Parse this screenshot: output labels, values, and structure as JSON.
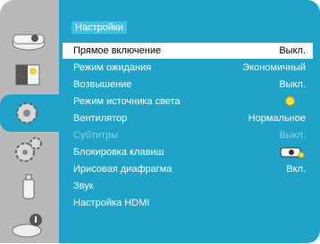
{
  "panel": {
    "title": "Настройки"
  },
  "sidebar": {
    "icons": [
      {
        "name": "projector-icon"
      },
      {
        "name": "image-adjust-icon"
      },
      {
        "name": "setting-gear-icon"
      },
      {
        "name": "expanded-settings-icon"
      },
      {
        "name": "usb-memory-icon"
      },
      {
        "name": "info-icon"
      }
    ],
    "active_index": 2
  },
  "menu": {
    "items": [
      {
        "label": "Прямое включение",
        "value": "Выкл."
      },
      {
        "label": "Режим ожидания",
        "value": "Экономичный"
      },
      {
        "label": "Возвышение",
        "value": "Выкл."
      },
      {
        "label": "Режим источника света",
        "value": ""
      },
      {
        "label": "Вентилятор",
        "value": "Нормальное"
      },
      {
        "label": "Субтитры",
        "value": "Выкл."
      },
      {
        "label": "Блокировка клавиш",
        "value": ""
      },
      {
        "label": "Ирисовая диафрагма",
        "value": "Вкл."
      },
      {
        "label": "Звук",
        "value": ""
      },
      {
        "label": "Настройка HDMI",
        "value": ""
      }
    ]
  },
  "colors": {
    "accent": "#1fa3c9",
    "sidebar": "#b9b9b9",
    "light_source_dot": "#f2e23a"
  }
}
